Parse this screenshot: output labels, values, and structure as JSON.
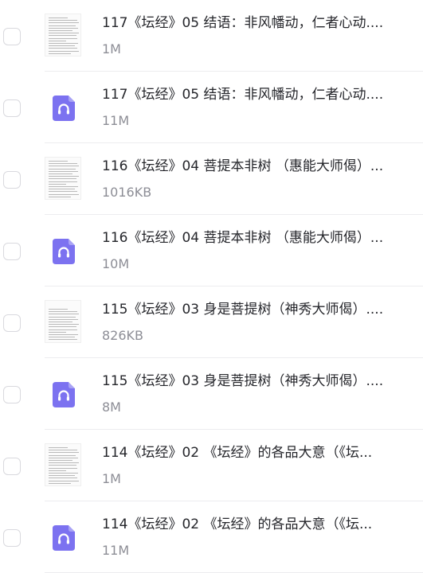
{
  "files": [
    {
      "title": "117《坛经》05 结语：非风幡动，仁者心动....",
      "size": "1M",
      "type": "document",
      "icon": "document-thumbnail-icon"
    },
    {
      "title": "117《坛经》05 结语：非风幡动，仁者心动....",
      "size": "11M",
      "type": "audio",
      "icon": "headphones-icon"
    },
    {
      "title": "116《坛经》04 菩提本非树 （惠能大师偈）...",
      "size": "1016KB",
      "type": "document",
      "icon": "document-thumbnail-icon"
    },
    {
      "title": "116《坛经》04 菩提本非树 （惠能大师偈）...",
      "size": "10M",
      "type": "audio",
      "icon": "headphones-icon"
    },
    {
      "title": "115《坛经》03 身是菩提树（神秀大师偈）....",
      "size": "826KB",
      "type": "document",
      "icon": "document-thumbnail-icon"
    },
    {
      "title": "115《坛经》03 身是菩提树（神秀大师偈）....",
      "size": "8M",
      "type": "audio",
      "icon": "headphones-icon"
    },
    {
      "title": "114《坛经》02 《坛经》的各品大意（《坛...",
      "size": "1M",
      "type": "document",
      "icon": "document-thumbnail-icon"
    },
    {
      "title": "114《坛经》02 《坛经》的各品大意（《坛...",
      "size": "11M",
      "type": "audio",
      "icon": "headphones-icon"
    }
  ],
  "colors": {
    "audio_icon": "#7c72f0",
    "title_text": "#25262b",
    "size_text": "#8d8e96",
    "checkbox_border": "#d9d9de"
  }
}
